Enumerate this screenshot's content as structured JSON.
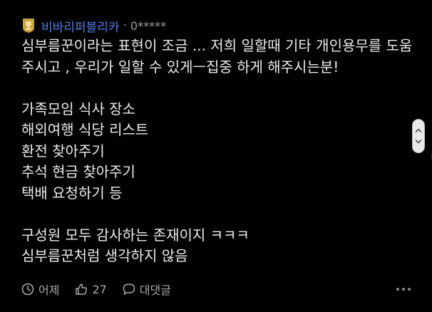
{
  "comment": {
    "author": "비바리퍼블리카",
    "separator": "·",
    "meta": "0*****",
    "lines": [
      "심부름꾼이라는 표현이 조금 ... 저희 일할때 기타 개인용무를 도움",
      "주시고 , 우리가 일할 수 있게ㅡ집중 하게 해주시는분!",
      "",
      "가족모임 식사 장소",
      "해외여행 식당 리스트",
      "환전 찾아주기",
      "추석 현금 찾아주기",
      "택배 요청하기 등",
      "",
      "구성원 모두 감사하는 존재이지 ㅋㅋㅋ",
      "심부름꾼처럼 생각하지 않음"
    ],
    "footer": {
      "time": "어제",
      "likes": "27",
      "reply_label": "대댓글"
    }
  },
  "icons": {
    "badge": "company-badge-icon",
    "clock": "clock-icon",
    "like": "thumbs-up-icon",
    "reply": "speech-bubble-icon",
    "more": "more-dots-icon",
    "scroll": "scroll-handle-icon"
  },
  "colors": {
    "background": "#000000",
    "author": "#4f7fe6",
    "text": "#ececec",
    "muted": "#a9a9a9",
    "badge_gold": "#c9a33c"
  }
}
